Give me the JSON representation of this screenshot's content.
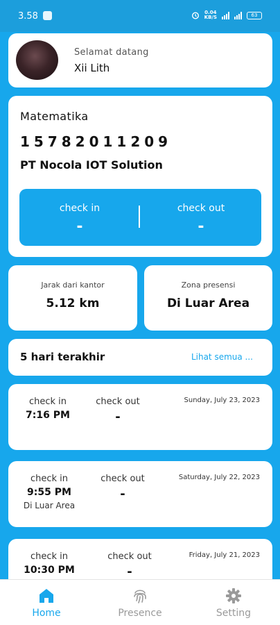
{
  "status_bar": {
    "time": "3.58",
    "speed": "0.04",
    "speed_unit": "KB/S",
    "battery": "63"
  },
  "profile": {
    "greeting": "Selamat datang",
    "name": "Xii Lith"
  },
  "course": {
    "subject": "Matematika",
    "code": "15782011209",
    "company": "PT Nocola IOT Solution",
    "check_in_label": "check in",
    "check_in_value": "-",
    "check_out_label": "check out",
    "check_out_value": "-"
  },
  "distance": {
    "label": "Jarak dari kantor",
    "value": "5.12 km"
  },
  "zone": {
    "label": "Zona presensi",
    "value": "Di Luar Area"
  },
  "recent": {
    "title": "5 hari terakhir",
    "see_all": "Lihat semua ..."
  },
  "history": [
    {
      "check_in_label": "check in",
      "check_in_time": "7:16 PM",
      "check_in_zone": "",
      "check_out_label": "check out",
      "check_out_value": "-",
      "date": "Sunday, July 23, 2023"
    },
    {
      "check_in_label": "check in",
      "check_in_time": "9:55 PM",
      "check_in_zone": "Di Luar Area",
      "check_out_label": "check out",
      "check_out_value": "-",
      "date": "Saturday, July 22, 2023"
    },
    {
      "check_in_label": "check in",
      "check_in_time": "10:30 PM",
      "check_in_zone": "",
      "check_out_label": "check out",
      "check_out_value": "-",
      "date": "Friday, July 21, 2023"
    }
  ],
  "nav": {
    "home": "Home",
    "presence": "Presence",
    "setting": "Setting"
  },
  "colors": {
    "accent": "#17a7ec",
    "inactive": "#9a9a9a"
  },
  "icons": {
    "home": "home-icon",
    "presence": "fingerprint-icon",
    "setting": "gear-icon"
  }
}
